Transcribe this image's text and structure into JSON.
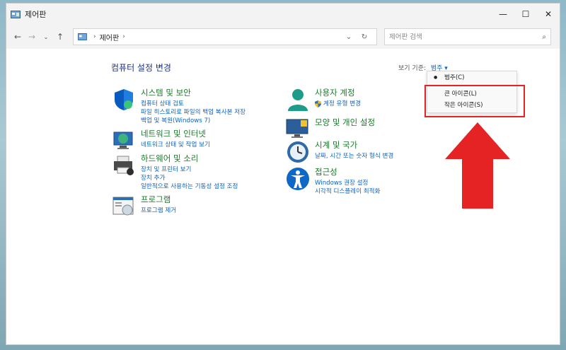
{
  "window": {
    "title": "제어판",
    "minimize_label": "—",
    "maximize_label": "☐",
    "close_label": "✕"
  },
  "address": {
    "breadcrumb": "제어판",
    "search_placeholder": "제어판 검색"
  },
  "main": {
    "title": "컴퓨터 설정 변경",
    "view_by_label": "보기 기준:",
    "view_by_value": "범주 ▾"
  },
  "categories": [
    {
      "title": "시스템 및 보안",
      "links": [
        "컴퓨터 상태 검토",
        "파일 히스토리로 파일의 백업 복사본 저장",
        "백업 및 복원(Windows 7)"
      ]
    },
    {
      "title": "네트워크 및 인터넷",
      "links": [
        "네트워크 상태 및 작업 보기"
      ]
    },
    {
      "title": "하드웨어 및 소리",
      "links": [
        "장치 및 프린터 보기",
        "장치 추가",
        "일반적으로 사용하는 기동성 설정 조정"
      ]
    },
    {
      "title": "프로그램",
      "links": [
        "프로그램 제거"
      ]
    },
    {
      "title": "사용자 계정",
      "links": [
        "계정 유형 변경"
      ]
    },
    {
      "title": "모양 및 개인 설정",
      "links": []
    },
    {
      "title": "시계 및 국가",
      "links": [
        "날짜, 시간 또는 숫자 형식 변경"
      ]
    },
    {
      "title": "접근성",
      "links": [
        "Windows 권장 설정",
        "시각적 디스플레이 최적화"
      ]
    }
  ],
  "view_menu": {
    "items": [
      "범주(C)",
      "큰 아이콘(L)",
      "작은 아이콘(S)"
    ],
    "selected": "범주(C)"
  },
  "colors": {
    "category_title": "#1a7a2a",
    "link": "#0b63c5",
    "annotation": "#e52224"
  }
}
